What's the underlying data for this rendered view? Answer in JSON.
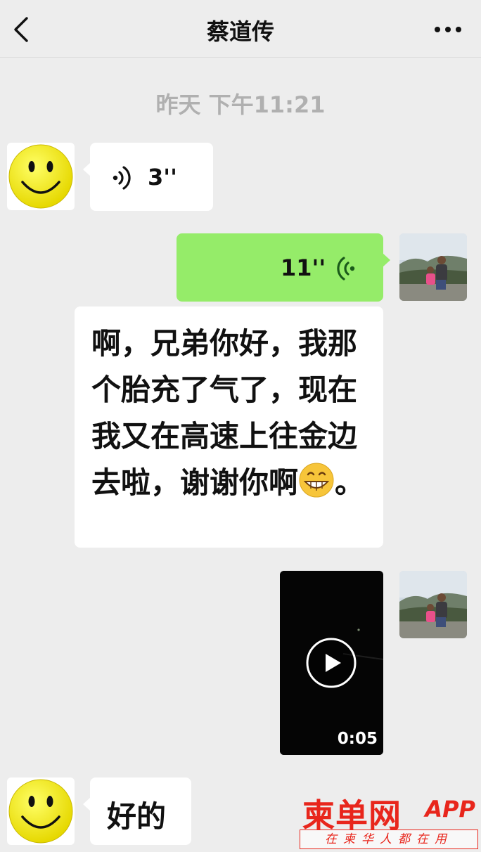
{
  "header": {
    "title": "蔡道传"
  },
  "timestamp": "昨天 下午11:21",
  "messages": {
    "voice_in": {
      "duration": "3''"
    },
    "voice_out": {
      "duration": "11''"
    },
    "text_in": {
      "line1": "啊，兄弟你好，我那个胎充了气了，现在我又在高速上往金边去啦，谢谢你啊",
      "emoji": "grinning-face",
      "tail": "。"
    },
    "video_out": {
      "duration": "0:05"
    },
    "reply_in": {
      "text": "好的"
    }
  },
  "watermark": {
    "brand": "柬单网",
    "app": "APP",
    "slogan": "在柬华人都在用"
  },
  "colors": {
    "background": "#ededed",
    "outgoing_bubble": "#95ec69",
    "incoming_bubble": "#ffffff",
    "brand_red": "#e8261c"
  },
  "icons": [
    "back-chevron-icon",
    "more-dots-icon",
    "smiley-avatar",
    "voice-wave-icon",
    "play-icon"
  ]
}
